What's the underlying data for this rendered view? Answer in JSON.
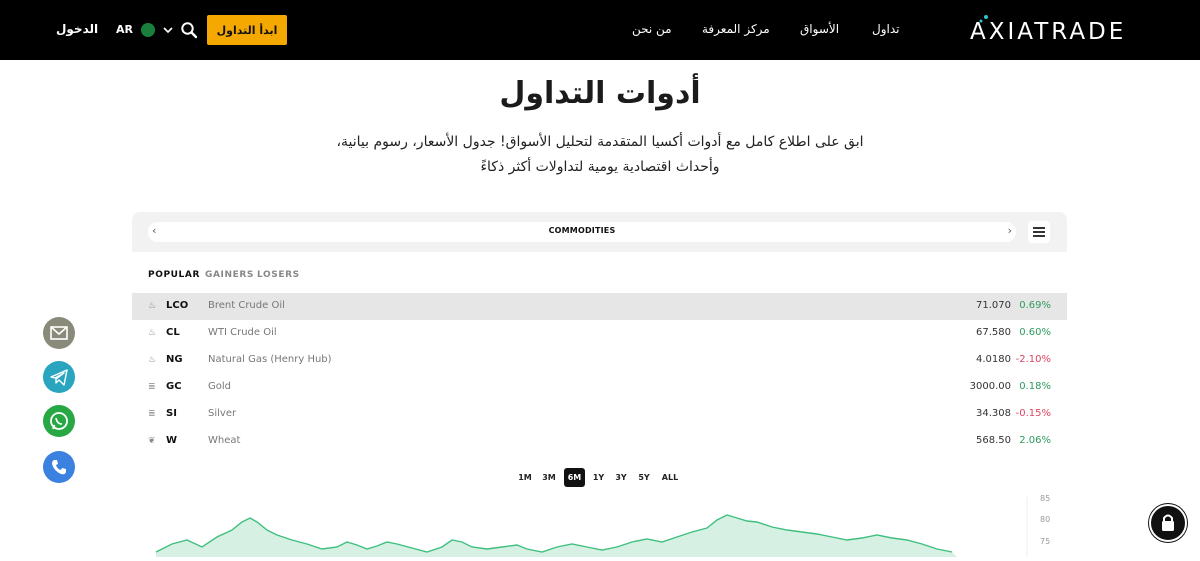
{
  "header": {
    "logo_text": "AXIATRADE",
    "nav": [
      {
        "label": "تداول"
      },
      {
        "label": "الأسواق"
      },
      {
        "label": "مركز المعرفة"
      },
      {
        "label": "من نحن"
      }
    ],
    "start_button": "ابدأ التداول",
    "language": "AR",
    "login": "الدخول"
  },
  "main": {
    "title": "أدوات التداول",
    "subtitle_line1": "ابق على اطلاع كامل مع أدوات أكسيا المتقدمة لتحليل الأسواق! جدول الأسعار، رسوم بيانية،",
    "subtitle_line2": "وأحداث اقتصادية يومية لتداولات أكثر ذكاءً"
  },
  "widget": {
    "category": "COMMODITIES",
    "tabs": [
      {
        "label": "POPULAR",
        "active": true
      },
      {
        "label": "GAINERS",
        "active": false
      },
      {
        "label": "LOSERS",
        "active": false
      }
    ],
    "rows": [
      {
        "icon": "flame-icon",
        "symbol": "LCO",
        "name": "Brent Crude Oil",
        "price": "71.070",
        "change": "0.69%",
        "dir": "pos"
      },
      {
        "icon": "flame-icon",
        "symbol": "CL",
        "name": "WTI Crude Oil",
        "price": "67.580",
        "change": "0.60%",
        "dir": "pos"
      },
      {
        "icon": "flame-icon",
        "symbol": "NG",
        "name": "Natural Gas (Henry Hub)",
        "price": "4.0180",
        "change": "-2.10%",
        "dir": "neg"
      },
      {
        "icon": "bars-icon",
        "symbol": "GC",
        "name": "Gold",
        "price": "3000.00",
        "change": "0.18%",
        "dir": "pos"
      },
      {
        "icon": "bars-icon",
        "symbol": "SI",
        "name": "Silver",
        "price": "34.308",
        "change": "-0.15%",
        "dir": "neg"
      },
      {
        "icon": "wheat-icon",
        "symbol": "W",
        "name": "Wheat",
        "price": "568.50",
        "change": "2.06%",
        "dir": "pos"
      }
    ],
    "ranges": [
      "1M",
      "3M",
      "6M",
      "1Y",
      "3Y",
      "5Y",
      "ALL"
    ],
    "active_range": "6M",
    "y_ticks": [
      "85",
      "80",
      "75"
    ]
  },
  "colors": {
    "accent": "#f5a800",
    "positive": "#2e9a5e",
    "negative": "#e04462",
    "chart_fill": "#d6f1e3",
    "chart_line": "#3fbf7f"
  }
}
